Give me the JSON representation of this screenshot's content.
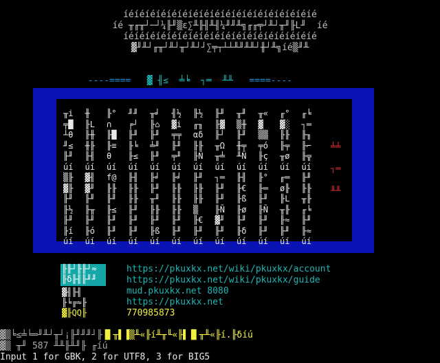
{
  "banner": {
    "line1": "íéíéíéíéíéíéíéíéíéíéíéíéíéíéíéíéíéíé",
    "line2": "íé ╥╓╥┘─┘¼╟╜▒ε∑╨╟╢╨╢¼╜╜╨╗╓╓╤┘╨┘╥╜╟L╜  íé",
    "line3": "íéíéíéíéíéíéíéíéíéíéíéíéíéíéíéíéíéíé",
    "line4": "▓╜╨┘╓╥┘╨┘╥┘╨┘┘∑╤┬┴┴╨╜╨╨┘╫┘╨╗íé▒╜╨",
    "divider_left": "----====",
    "divider_mid": "▓ ╢≤  ╧╘  ┐═  ╨╨",
    "divider_right": "====----"
  },
  "grid_cells": [
    "╥i",
    "╫",
    "╟°",
    "╜╜",
    "╥╛",
    "╢½",
    "╟½",
    "╟╜",
    "╥╜",
    "╥«",
    "╓°",
    "╓╘",
    "╤█",
    "╟L",
    "∩",
    "╒┘",
    "╟⌂",
    "▓i",
    "╓╖",
    "╟▓",
    "▒╫",
    "▓",
    "▓░",
    "┐═",
    "┴θ",
    "╟╫",
    "╟█",
    "╟╜",
    "╟╜",
    "╤╤",
    "αδ",
    "╟┘",
    "╟╜",
    "▒▒",
    "╟╟",
    "╟╖",
    "╜≤",
    "╫╟",
    "╟≡",
    "╟╘",
    "╧╜",
    "╟╜",
    "╟╟",
    "╥Ω",
    "╫╤",
    "╤ó",
    "╟╤",
    "╟⌐",
    "╟╜",
    "╟╢",
    "θ",
    "╟≤",
    "╟╜",
    "╤╜",
    "╟Ñ",
    "╥╧",
    "╨Ñ",
    "╟ç",
    "╥ø",
    "╟╦",
    "úí",
    "úí",
    "úí",
    "úí",
    "úí",
    "úí",
    "úí",
    "úí",
    "úí",
    "úí",
    "úí",
    "úí",
    "▒╟",
    "▓╢",
    "f@",
    "╟╢",
    "╟╛",
    "╟╛",
    "╟╜",
    "┐═",
    "╟╢",
    "╟°",
    "╓═",
    "╟╜",
    "▓╟",
    "▓╜",
    "╟╟",
    "╟╟",
    "╟╜",
    "╟╟",
    "╟╟",
    "╟╜",
    "╟€",
    "╟═",
    "ø╟",
    "╟╟",
    "╟╜",
    "╟╜",
    "╟╜",
    "╟╟",
    "╥╜",
    "╟╟",
    "╟╟",
    "╟╜",
    "╟ß",
    "╟╜",
    "╟L",
    "╥╟",
    "╟½",
    "╟╥",
    "╟≤",
    "╟╜",
    "╟╟",
    "╟╟",
    "▒",
    "╟Ñ",
    "╟ø",
    "╟Ñ",
    "╥╟",
    "╓╘",
    "╟╜",
    "╟╜",
    "╟╜",
    "╟╜",
    "╟╜",
    "╟╜",
    "╟€",
    "▓╜",
    "╟╜",
    "╟╜",
    "╟≈",
    "╟╜",
    "╟í",
    "╟ó",
    "╟╜",
    "╟╜",
    "╟ß",
    "╟╜",
    "╟╜",
    "╟╜",
    "╟δ",
    "╟╜",
    "╟╜",
    "╟≈",
    "úí",
    "úí",
    "úí",
    "úí",
    "úí",
    "úí",
    "úí",
    "úí",
    "úí",
    "úí",
    "úí",
    "úí"
  ],
  "side_symbols": [
    "╧╧",
    "┐═",
    "╨╨"
  ],
  "logo": {
    "row1": "╟╟┘╟╟┘≈",
    "row2": "╟δ╟╢╟╜╜",
    "row3": "▓╢╟╢",
    "row4": "╟╘╔≈╟",
    "row5": "▓╟QQ╟"
  },
  "links": {
    "account": "https://pkuxkx.net/wiki/pkuxkx/account",
    "guide": "https://pkuxkx.net/wiki/pkuxkx/guide",
    "mud": "mud.pkuxkx.net 8080",
    "home": "https://pkuxkx.net",
    "qq": "770985873"
  },
  "footer": {
    "line1a": "▓▒╘≤╧╘═╜╨┘╥┘¡╟╜╜╜┘╟",
    "line1b": "▐▌╥▌▐▒╨«╟í╨╥╙«╟▌▐▌╥╨«╟í.╟δíú",
    "line2": "▓▒ ╥╜ 587 ╨╨╟╨╜╟ ╓íú",
    "prompt": "Input 1 for GBK, 2 for UTF8, 3 for BIG5"
  },
  "colors": {
    "frame": "#0a14b4",
    "cyan": "#1fb5b5",
    "yellow": "#f0f040",
    "red": "#e03030"
  }
}
